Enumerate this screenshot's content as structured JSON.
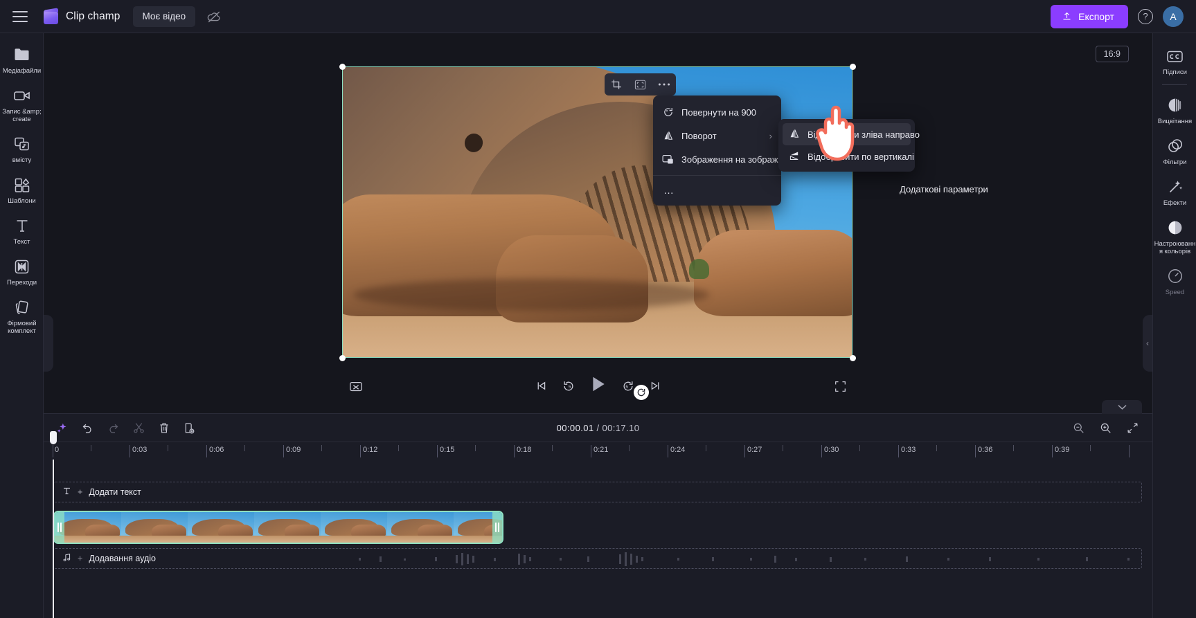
{
  "topbar": {
    "menu_icon": "hamburger-icon",
    "brand": "Clip champ",
    "project_tab": "Моє відео",
    "cloud_icon": "cloud-off-icon",
    "export_label": "Експорт",
    "help_icon": "question-mark-icon",
    "avatar_initial": "A"
  },
  "left_rail": [
    {
      "label": "Медіафайли",
      "icon": "folder-icon",
      "dim": false
    },
    {
      "label": "Запис &amp; create",
      "icon": "camera-icon",
      "dim": false
    },
    {
      "label": "вмісту",
      "icon": "content-library-icon",
      "dim": false
    },
    {
      "label": "Шаблони",
      "icon": "templates-icon",
      "dim": false
    },
    {
      "label": "Текст",
      "icon": "text-icon",
      "dim": false
    },
    {
      "label": "Переходи",
      "icon": "transitions-icon",
      "dim": false
    },
    {
      "label": "Фірмовий комплект",
      "icon": "brand-kit-icon",
      "dim": false
    }
  ],
  "right_rail": [
    {
      "label": "Підписи",
      "icon": "captions-cc-icon"
    },
    {
      "label": "Вицвітання",
      "icon": "fade-icon"
    },
    {
      "label": "Фільтри",
      "icon": "filters-icon"
    },
    {
      "label": "Ефекти",
      "icon": "effects-wand-icon"
    },
    {
      "label": "Настроювання кольорів",
      "icon": "color-adjust-icon"
    },
    {
      "label": "Speed",
      "icon": "speedometer-icon"
    }
  ],
  "stage": {
    "ratio_badge": "16:9",
    "float_tools": [
      "crop-icon",
      "fit-icon",
      "more-dots-icon"
    ],
    "extra_params_label": "Додаткові параметри",
    "rotate_handle_icon": "rotate-icon"
  },
  "context_menu": {
    "items": [
      {
        "label": "Повернути на 900",
        "icon": "rotate-90-icon",
        "has_submenu": false
      },
      {
        "label": "Поворот",
        "icon": "flip-icon",
        "has_submenu": true
      },
      {
        "label": "Зображення на зображенні",
        "icon": "picture-in-picture-icon",
        "has_submenu": true
      }
    ],
    "more_dots": "…"
  },
  "submenu": {
    "items": [
      {
        "label": "Відобразити зліва направо",
        "icon": "flip-horizontal-icon",
        "highlighted": true
      },
      {
        "label": "Відобразити по вертикалі",
        "icon": "flip-vertical-icon",
        "highlighted": false
      }
    ]
  },
  "playback": {
    "buttons": [
      "captions-off-icon",
      "skip-start-icon",
      "rewind-5-icon",
      "play-icon",
      "forward-5-icon",
      "skip-end-icon",
      "fullscreen-icon"
    ]
  },
  "timeline": {
    "tools": [
      "sparkle-ai-icon",
      "undo-icon",
      "redo-icon",
      "scissors-icon",
      "delete-icon",
      "split-icon"
    ],
    "current_time": "00:00.01",
    "separator": "/",
    "total_time": "00:17.10",
    "zoom_tools": [
      "zoom-out-icon",
      "zoom-in-icon",
      "fit-timeline-icon"
    ],
    "collapse_icon": "chevron-down-icon",
    "ruler_labels": [
      "0",
      "0:03",
      "0:06",
      "0:09",
      "0:12",
      "0:15",
      "0:18",
      "0:21",
      "0:24",
      "0:27",
      "0:30",
      "0:33",
      "0:36",
      "0:39"
    ],
    "text_track": {
      "icon": "text-t-icon",
      "plus": "+",
      "label": "Додати текст"
    },
    "audio_track": {
      "icon": "music-note-icon",
      "plus": "+",
      "label": "Додавання аудіо"
    },
    "video_clip": {
      "selected": true,
      "trim_handles": 2
    }
  },
  "colors": {
    "accent_purple": "#8b3dff",
    "selection_green": "#8fe0c2",
    "panel_bg": "#1b1c26",
    "stage_bg": "#15161d",
    "menu_bg": "#22232e",
    "cursor_red": "#f26d5b"
  }
}
